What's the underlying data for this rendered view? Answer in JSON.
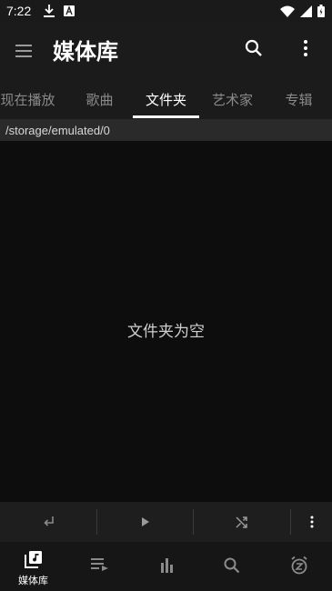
{
  "status_bar": {
    "time": "7:22",
    "left_icons": [
      "download-icon",
      "app-notification-icon"
    ],
    "right_icons": [
      "wifi-icon",
      "signal-icon",
      "battery-icon"
    ]
  },
  "app_bar": {
    "title": "媒体库",
    "menu_icon": "menu-icon",
    "search_icon": "search-icon",
    "more_icon": "more-vert-icon"
  },
  "tabs": [
    {
      "label": "现在播放",
      "active": false
    },
    {
      "label": "歌曲",
      "active": false
    },
    {
      "label": "文件夹",
      "active": true
    },
    {
      "label": "艺术家",
      "active": false
    },
    {
      "label": "专辑",
      "active": false
    }
  ],
  "folder": {
    "path": "/storage/emulated/0",
    "empty_message": "文件夹为空"
  },
  "playback": {
    "buttons": [
      "return-icon",
      "play-icon",
      "shuffle-icon",
      "more-vert-icon"
    ]
  },
  "bottom_nav": [
    {
      "icon": "library-music-icon",
      "label": "媒体库",
      "active": true
    },
    {
      "icon": "playlist-icon",
      "label": "",
      "active": false
    },
    {
      "icon": "equalizer-icon",
      "label": "",
      "active": false
    },
    {
      "icon": "search-icon",
      "label": "",
      "active": false
    },
    {
      "icon": "sleep-timer-icon",
      "label": "",
      "active": false
    }
  ],
  "colors": {
    "background": "#0d0d0d",
    "app_bar": "#1b1b1b",
    "path_bar": "#2a2a2a",
    "tab_inactive": "#8a8a8a",
    "tab_active": "#ffffff"
  }
}
